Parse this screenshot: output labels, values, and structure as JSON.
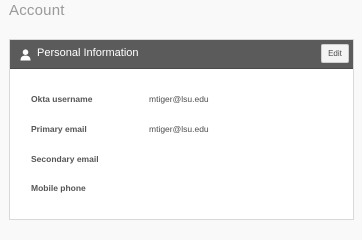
{
  "page": {
    "title": "Account"
  },
  "personal_info": {
    "title": "Personal Information",
    "icon": "user-icon",
    "edit_label": "Edit",
    "fields": [
      {
        "label": "Okta username",
        "value": "mtiger@lsu.edu"
      },
      {
        "label": "Primary email",
        "value": "mtiger@lsu.edu"
      },
      {
        "label": "Secondary email",
        "value": ""
      },
      {
        "label": "Mobile phone",
        "value": ""
      }
    ]
  },
  "colors": {
    "header_bg": "#5b5b5b",
    "page_bg": "#f9f9f9",
    "card_bg": "#ffffff"
  }
}
